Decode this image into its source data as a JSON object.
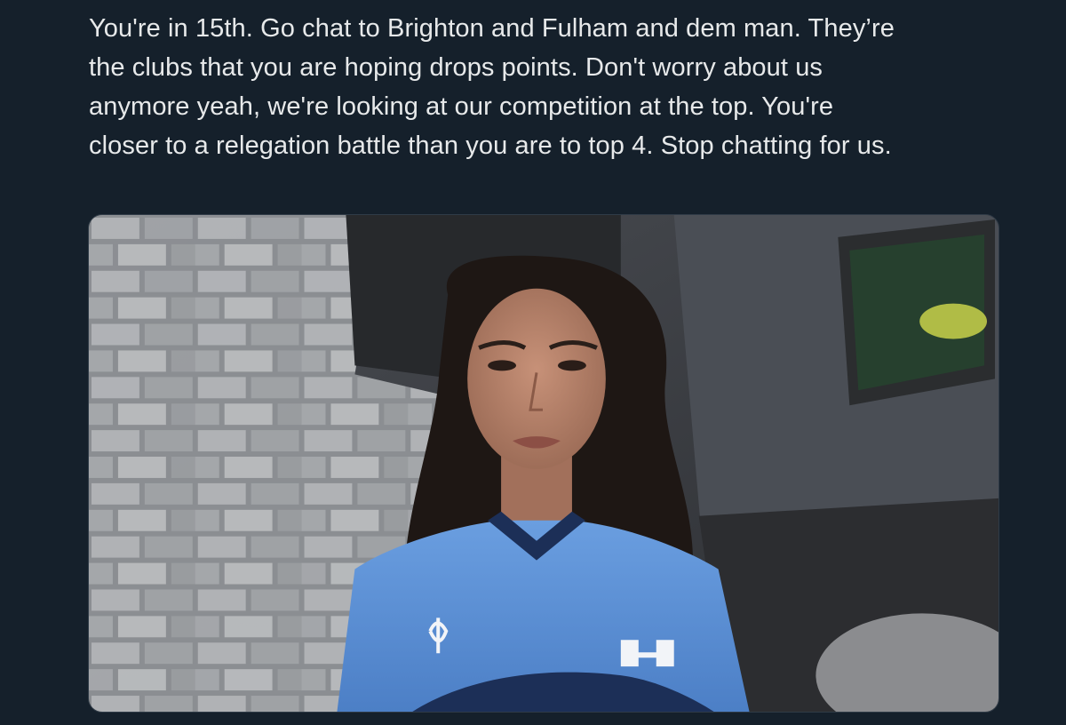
{
  "tweet": {
    "text_lines": [
      "You're in 15th. Go chat to Brighton and Fulham and dem man. They’re",
      "the clubs that you are hoping drops points. Don't worry about us",
      "anymore yeah, we're looking at our competition at the top. You're",
      "closer to a relegation battle than you are to top 4. Stop chatting for us."
    ]
  },
  "media": {
    "kind": "video-still",
    "icon": "video-thumbnail-icon"
  },
  "colors": {
    "background": "#15202b",
    "text": "#e7e9ea",
    "jersey": "#5a8fd6",
    "jersey_dark": "#1c2f57",
    "hair": "#1e1714",
    "skin": "#b07d63"
  }
}
